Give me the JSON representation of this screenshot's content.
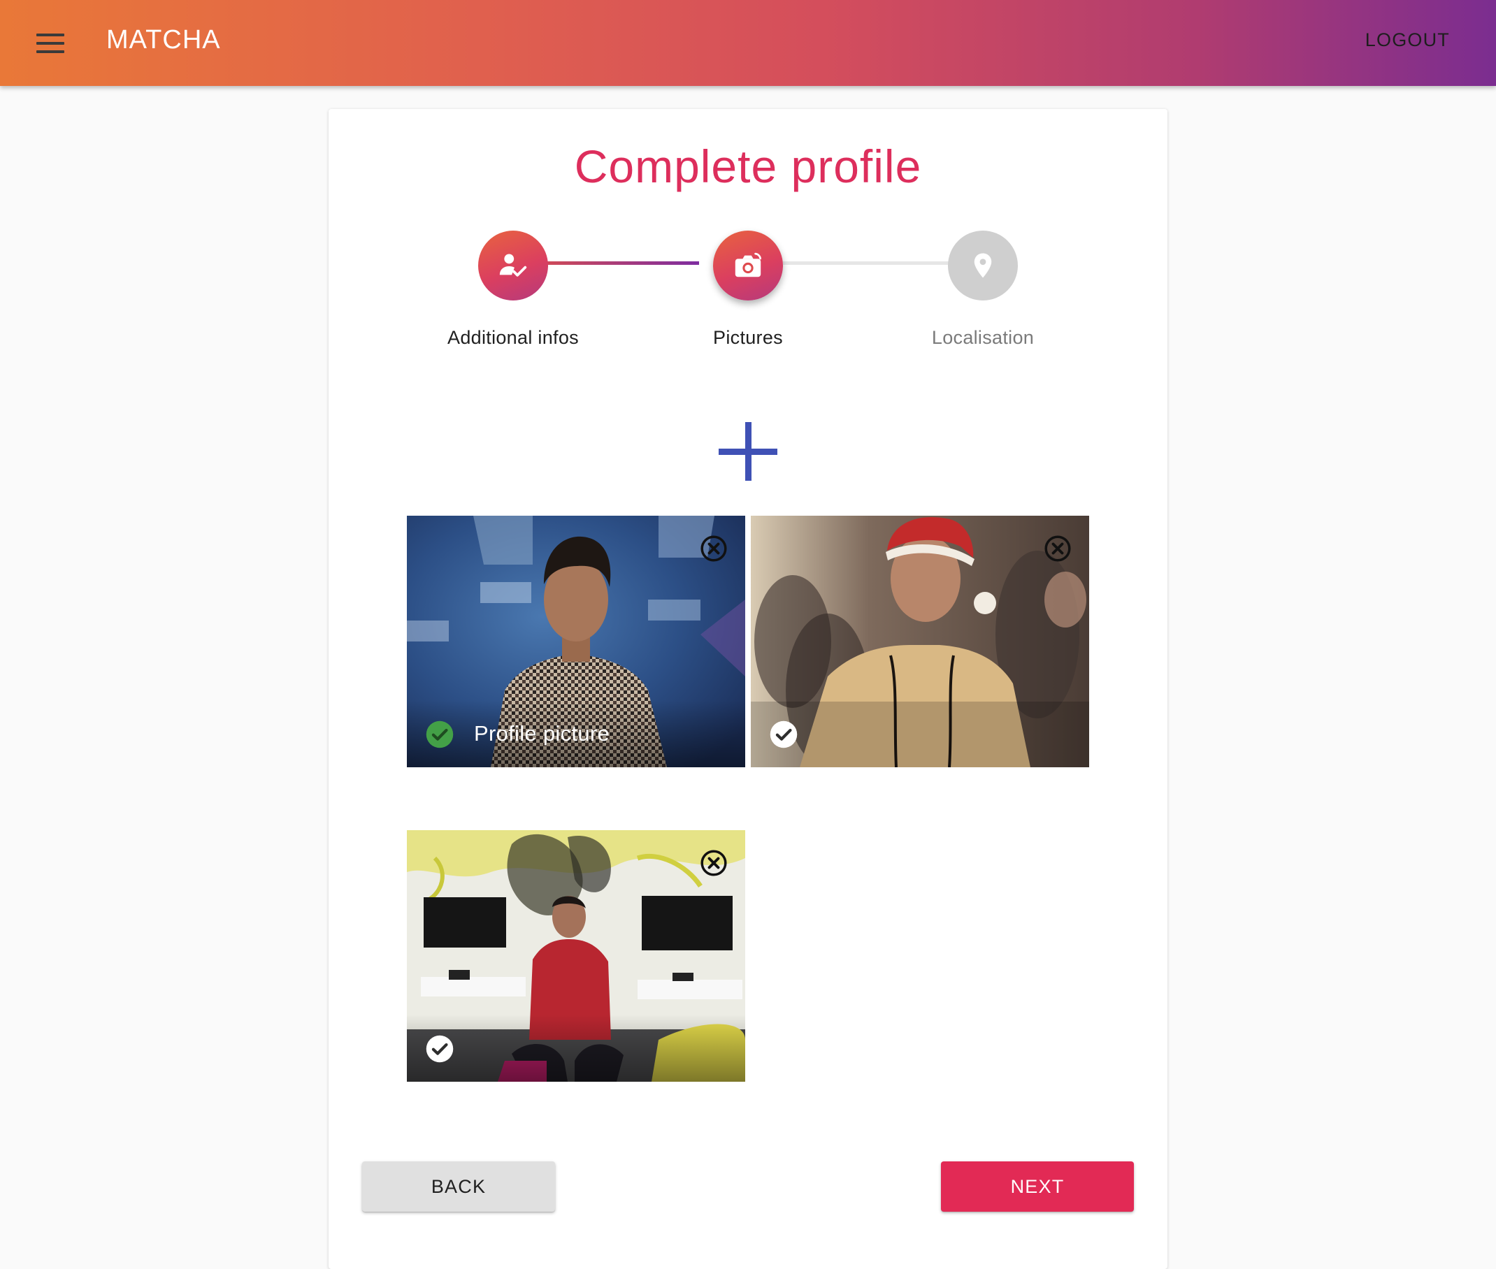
{
  "app": {
    "title": "MATCHA",
    "logout_label": "LOGOUT"
  },
  "page": {
    "title": "Complete profile"
  },
  "stepper": {
    "steps": [
      {
        "label": "Additional infos",
        "icon": "person-check-icon",
        "state": "completed"
      },
      {
        "label": "Pictures",
        "icon": "camera-icon",
        "state": "current"
      },
      {
        "label": "Localisation",
        "icon": "location-pin-icon",
        "state": "pending"
      }
    ]
  },
  "pictures": {
    "add_icon": "plus-icon",
    "items": [
      {
        "caption": "Profile picture",
        "is_profile": true
      },
      {
        "caption": "",
        "is_profile": false
      },
      {
        "caption": "",
        "is_profile": false
      }
    ]
  },
  "actions": {
    "back_label": "BACK",
    "next_label": "NEXT"
  },
  "colors": {
    "accent": "#e22a55",
    "title": "#dd2e5c",
    "add_icon": "#3f51b5",
    "check_green": "#43a047",
    "appbar_start": "#e97838",
    "appbar_end": "#7b2d90"
  }
}
